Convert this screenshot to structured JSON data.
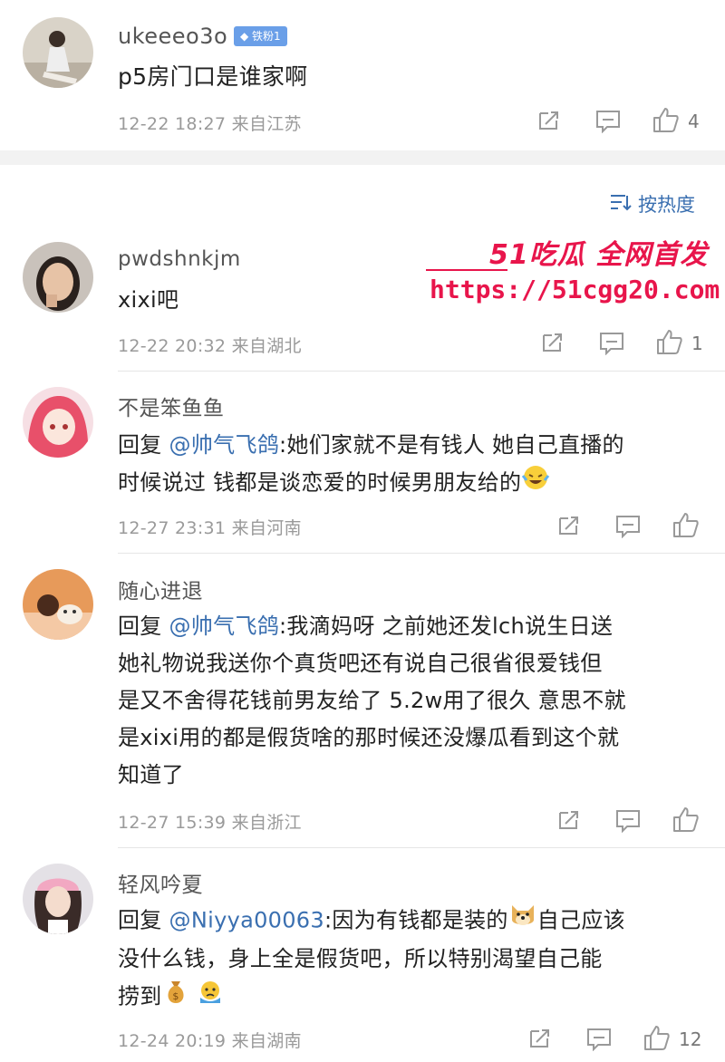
{
  "top_comment": {
    "username": "ukeeeo3o",
    "badge": "铁粉1",
    "text": "p5房门口是谁家啊",
    "time": "12-22 18:27",
    "location": "来自江苏",
    "likes": "4"
  },
  "sort": {
    "label": "按热度"
  },
  "watermark": {
    "title": "51吃瓜 全网首发",
    "url": "https://51cgg20.com"
  },
  "comments": [
    {
      "username": "pwdshnkjm",
      "text": "xixi吧",
      "time": "12-22 20:32",
      "location": "来自湖北",
      "likes": "1"
    },
    {
      "username": "不是笨鱼鱼",
      "reply_prefix": "回复",
      "mention": "@帅气飞鸽",
      "line1": ":她们家就不是有钱人 她自己直播的",
      "line2": "时候说过 钱都是谈恋爱的时候男朋友给的",
      "emoji": "laugh-cry-emoji",
      "time": "12-27 23:31",
      "location": "来自河南",
      "likes": ""
    },
    {
      "username": "随心进退",
      "reply_prefix": "回复",
      "mention": "@帅气飞鸽",
      "line1": ":我滴妈呀 之前她还发lch说生日送",
      "line2": "她礼物说我送你个真货吧还有说自己很省很爱钱但",
      "line3": "是又不舍得花钱前男友给了 5.2w用了很久 意思不就",
      "line4": "是xixi用的都是假货啥的那时候还没爆瓜看到这个就",
      "line5": "知道了",
      "time": "12-27 15:39",
      "location": "来自浙江",
      "likes": ""
    },
    {
      "username": "轻风吟夏",
      "reply_prefix": "回复",
      "mention": "@Niyya00063",
      "line1a": ":因为有钱都是装的",
      "line1b": "自己应该",
      "line2": "没什么钱，身上全是假货吧，所以特别渴望自己能",
      "line3": "捞到",
      "emoji1": "doge-emoji",
      "emoji2": "money-bag-emoji",
      "emoji3": "sad-face-emoji",
      "time": "12-24 20:19",
      "location": "来自湖南",
      "likes": "12"
    }
  ],
  "colors": {
    "mention": "#3a6fb0",
    "badge": "#6a9fe8",
    "watermark": "#e8154b"
  }
}
